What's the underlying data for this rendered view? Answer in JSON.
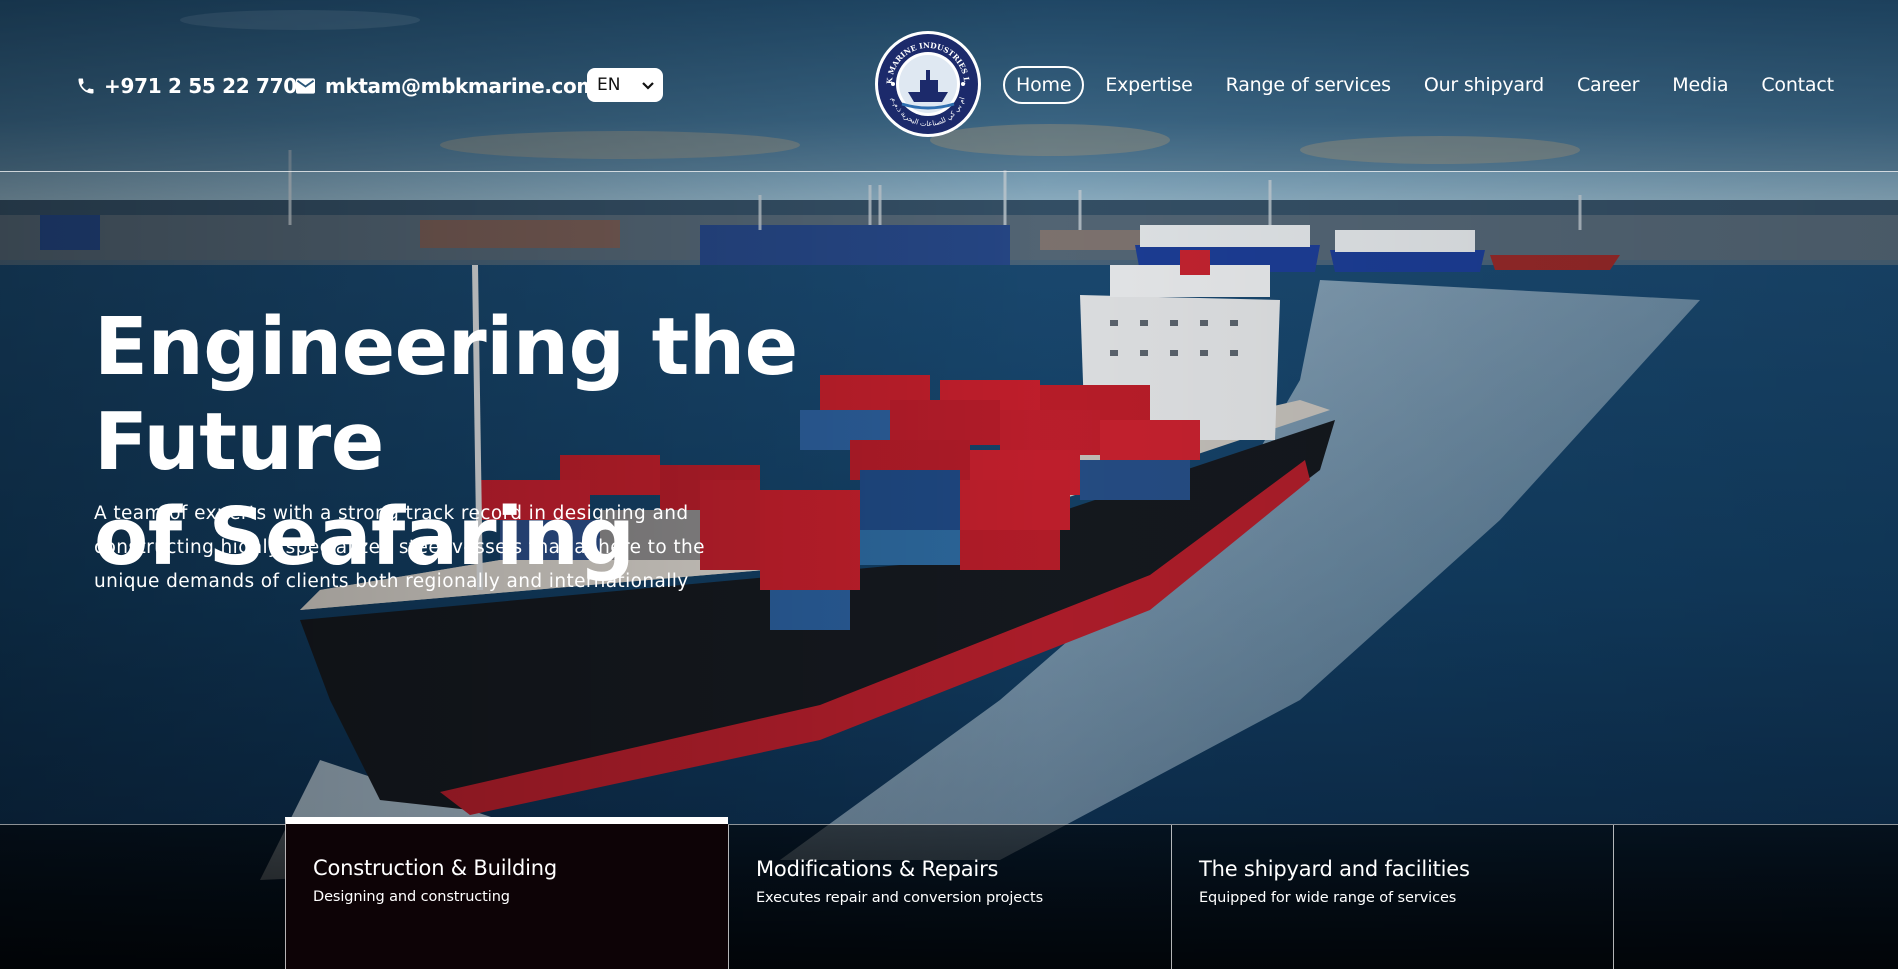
{
  "header": {
    "phone": "+971 2 55 22 770",
    "email": "mktam@mbkmarine.com",
    "language": "EN",
    "logo_text": "MBK MARINE INDUSTRIES L.L.C",
    "logo_text_arabic": "ام بي كي للصناعات البحرية ذ.م.م"
  },
  "nav": {
    "items": [
      {
        "label": "Home",
        "active": true
      },
      {
        "label": "Expertise"
      },
      {
        "label": "Range of services"
      },
      {
        "label": "Our shipyard"
      },
      {
        "label": "Career"
      },
      {
        "label": "Media"
      },
      {
        "label": "Contact"
      }
    ]
  },
  "hero": {
    "title_line1": "Engineering the Future",
    "title_line2": "of Seafaring",
    "subtitle": "A team of experts with a strong track record in designing and constructing highly specialized steel vessels that adhere to the unique demands of clients both regionally and internationally"
  },
  "tabs": [
    {
      "title": "Construction & Building",
      "desc": "Designing and constructing",
      "active": true
    },
    {
      "title": "Modifications & Repairs",
      "desc": "Executes repair and conversion projects"
    },
    {
      "title": "The shipyard and facilities",
      "desc": "Equipped for wide range of services"
    }
  ],
  "icons": {
    "phone": "phone-icon",
    "email": "mail-icon",
    "dropdown": "chevron-down-icon"
  },
  "colors": {
    "text": "#ffffff",
    "sea": "#123e63",
    "active_tab_bg": "#0d0306"
  }
}
